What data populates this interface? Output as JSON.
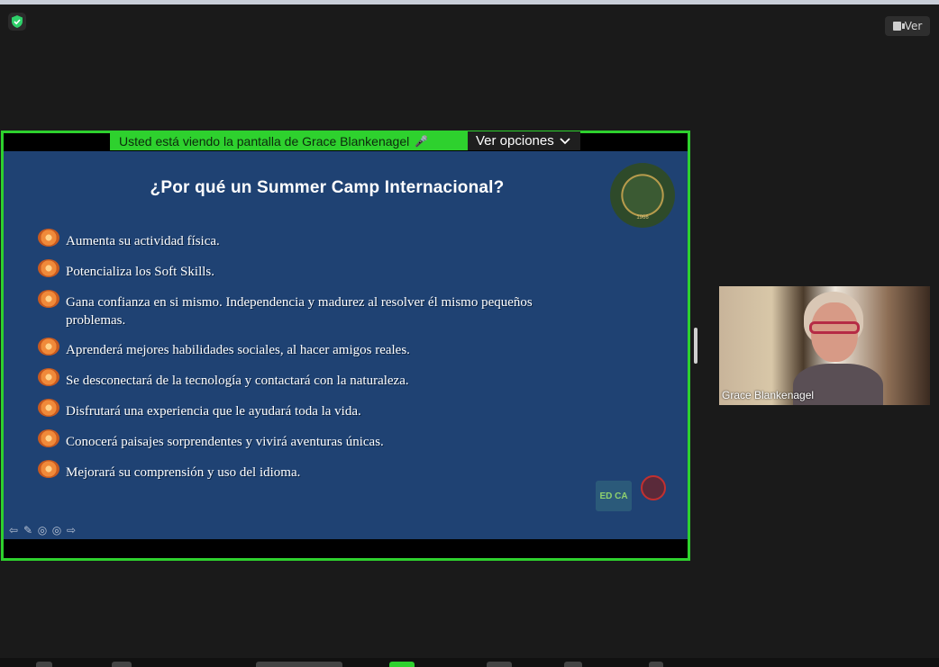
{
  "meeting": {
    "view_button_label": "Ver",
    "share_banner": "Usted está viendo la pantalla de Grace Blankenagel",
    "view_options_label": "Ver opciones"
  },
  "slide": {
    "title": "¿Por qué un Summer Camp Internacional?",
    "bullets": [
      "Aumenta su actividad física.",
      "Potencializa los Soft Skills.",
      "Gana confianza en si mismo. Independencia y madurez al resolver él mismo pequeños problemas.",
      "Aprenderá mejores habilidades sociales, al hacer amigos reales.",
      "Se desconectará de la tecnología y contactará con la naturaleza.",
      "Disfrutará una experiencia que le ayudará toda la vida.",
      "Conocerá paisajes sorprendentes y vivirá aventuras únicas.",
      "Mejorará su comprensión y uso del idioma."
    ],
    "seal_year": "1966",
    "logo_edca": "ED CA"
  },
  "participant": {
    "name": "Grace Blankenagel"
  },
  "colors": {
    "share_border": "#2ed12e",
    "slide_background": "#1f4273"
  }
}
